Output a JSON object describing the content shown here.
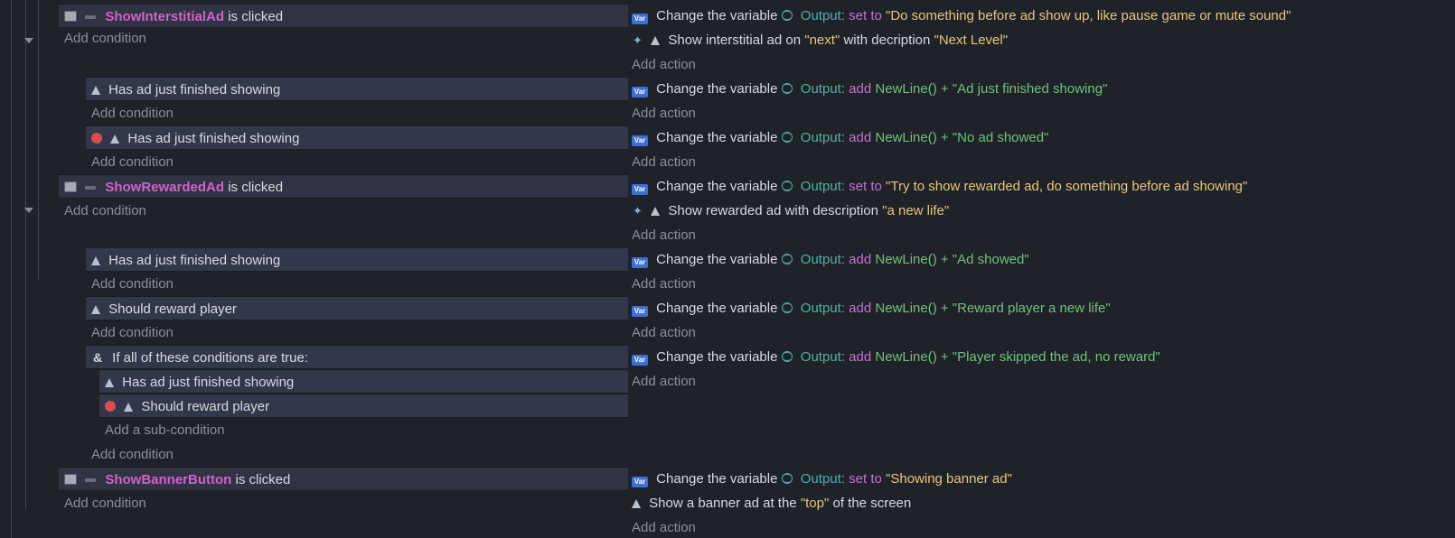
{
  "labels": {
    "add_condition": "Add condition",
    "add_sub_condition": "Add a sub-condition",
    "add_action": "Add action",
    "is_clicked": "is clicked",
    "change_var": "Change the variable",
    "output": "Output",
    "set_to": "set to",
    "add_op": "add",
    "if_all": "If all of these conditions are true:"
  },
  "events": [
    {
      "object": "ShowInterstitialAd",
      "conditions": [
        "is clicked"
      ],
      "actions": [
        {
          "kind": "setvar",
          "op": "set to",
          "value": "\"Do something before ad show up, like pause game or mute sound\""
        },
        {
          "kind": "raw",
          "prefix": "Show interstitial ad on ",
          "str1": "\"next\"",
          "mid": " with decription ",
          "str2": "\"Next Level\""
        }
      ],
      "sub": [
        {
          "conditions": [
            "Has ad just finished showing"
          ],
          "actions": [
            {
              "kind": "setvar",
              "op": "add",
              "expr": "NewLine() + \"Ad just finished showing\""
            }
          ]
        },
        {
          "red": true,
          "conditions": [
            "Has ad just finished showing"
          ],
          "actions": [
            {
              "kind": "setvar",
              "op": "add",
              "expr": "NewLine() + \"No ad showed\""
            }
          ]
        }
      ]
    },
    {
      "object": "ShowRewardedAd",
      "conditions": [
        "is clicked"
      ],
      "actions": [
        {
          "kind": "setvar",
          "op": "set to",
          "value": "\"Try to show rewarded ad, do something before ad showing\""
        },
        {
          "kind": "raw",
          "prefix": "Show rewarded ad with description ",
          "str1": "\"a new life\""
        }
      ],
      "sub": [
        {
          "conditions": [
            "Has ad just finished showing"
          ],
          "actions": [
            {
              "kind": "setvar",
              "op": "add",
              "expr": "NewLine() + \"Ad showed\""
            }
          ]
        },
        {
          "conditions": [
            "Should reward player"
          ],
          "actions": [
            {
              "kind": "setvar",
              "op": "add",
              "expr": "NewLine() + \"Reward player a new life\""
            }
          ]
        },
        {
          "and": true,
          "conditions": [
            "Has ad just finished showing",
            "Should reward player"
          ],
          "red_index": 1,
          "actions": [
            {
              "kind": "setvar",
              "op": "add",
              "expr": "NewLine() + \"Player skipped the ad, no reward\""
            }
          ]
        }
      ]
    },
    {
      "object": "ShowBannerButton",
      "conditions": [
        "is clicked"
      ],
      "actions": [
        {
          "kind": "setvar",
          "op": "set to",
          "value": "\"Showing banner ad\""
        },
        {
          "kind": "raw",
          "prefix": "Show a banner ad at the",
          "str1": "\"top\"",
          "mid": " of the screen"
        }
      ]
    }
  ]
}
